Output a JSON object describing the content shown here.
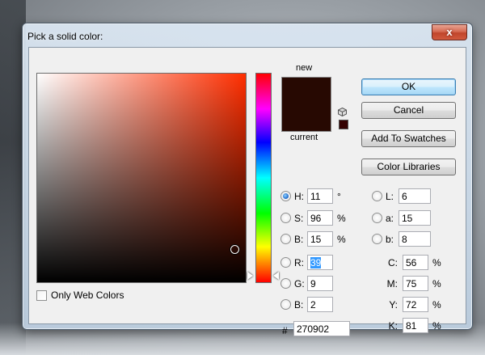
{
  "window": {
    "title": "Pick a solid color:",
    "close_label": "x"
  },
  "preview": {
    "new_label": "new",
    "current_label": "current",
    "new_color": "#270902",
    "current_color": "#270902"
  },
  "options": {
    "only_web_colors_label": "Only Web Colors",
    "only_web_colors_checked": false
  },
  "buttons": {
    "ok": "OK",
    "cancel": "Cancel",
    "add_to_swatches": "Add To Swatches",
    "color_libraries": "Color Libraries"
  },
  "hsb": {
    "h": {
      "label": "H:",
      "value": "11",
      "unit": "°",
      "selected": true
    },
    "s": {
      "label": "S:",
      "value": "96",
      "unit": "%"
    },
    "b": {
      "label": "B:",
      "value": "15",
      "unit": "%"
    }
  },
  "rgb": {
    "r": {
      "label": "R:",
      "value": "39"
    },
    "g": {
      "label": "G:",
      "value": "9"
    },
    "b": {
      "label": "B:",
      "value": "2"
    }
  },
  "lab": {
    "l": {
      "label": "L:",
      "value": "6"
    },
    "a": {
      "label": "a:",
      "value": "15"
    },
    "b": {
      "label": "b:",
      "value": "8"
    }
  },
  "cmyk": {
    "c": {
      "label": "C:",
      "value": "56",
      "unit": "%"
    },
    "m": {
      "label": "M:",
      "value": "75",
      "unit": "%"
    },
    "y": {
      "label": "Y:",
      "value": "72",
      "unit": "%"
    },
    "k": {
      "label": "K:",
      "value": "81",
      "unit": "%"
    }
  },
  "hex": {
    "label": "#",
    "value": "270902"
  }
}
